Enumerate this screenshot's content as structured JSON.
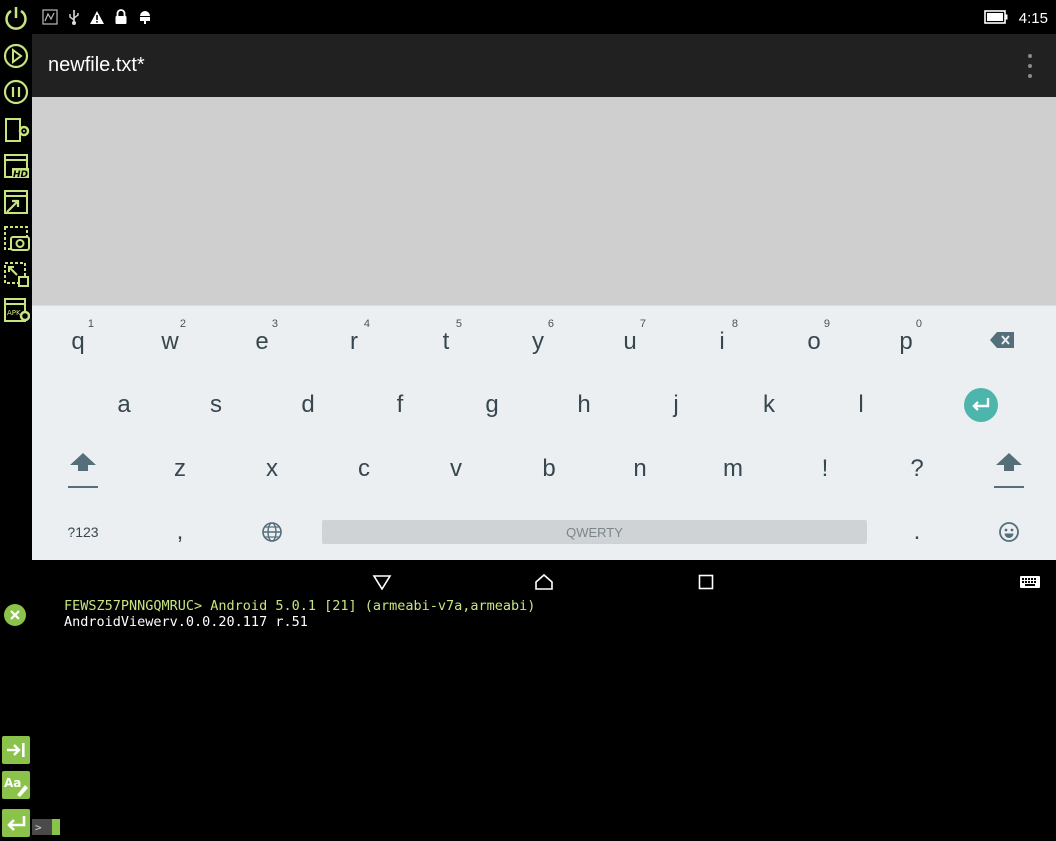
{
  "status_bar": {
    "time": "4:15",
    "icons": [
      "screen-capture-icon",
      "usb-icon",
      "warning-icon",
      "lock-icon",
      "android-debug-icon",
      "battery-icon"
    ]
  },
  "app_bar": {
    "title": "newfile.txt*",
    "overflow_icon": "more-vert-icon"
  },
  "editor": {
    "content": ""
  },
  "keyboard": {
    "row1": [
      {
        "label": "q",
        "hint": "1"
      },
      {
        "label": "w",
        "hint": "2"
      },
      {
        "label": "e",
        "hint": "3"
      },
      {
        "label": "r",
        "hint": "4"
      },
      {
        "label": "t",
        "hint": "5"
      },
      {
        "label": "y",
        "hint": "6"
      },
      {
        "label": "u",
        "hint": "7"
      },
      {
        "label": "i",
        "hint": "8"
      },
      {
        "label": "o",
        "hint": "9"
      },
      {
        "label": "p",
        "hint": "0"
      }
    ],
    "row2": [
      "a",
      "s",
      "d",
      "f",
      "g",
      "h",
      "j",
      "k",
      "l"
    ],
    "row3": [
      "z",
      "x",
      "c",
      "v",
      "b",
      "n",
      "m",
      "!",
      "?"
    ],
    "symbols_label": "?123",
    "comma_label": ",",
    "space_label": "QWERTY",
    "period_label": ".",
    "accent_color": "#4db6ac"
  },
  "console": {
    "line1": "FEWSZ57PNNGQMRUC> Android 5.0.1 [21] (armeabi-v7a,armeabi)",
    "line2": "AndroidViewerv.0.0.20.117 r.51",
    "prompt": ">"
  },
  "colors": {
    "tool_green": "#c6e57f",
    "action_green": "#8bc34a",
    "app_bar": "#212121",
    "editor_bg": "#cfcfcf",
    "keyboard_bg": "#eceff1"
  }
}
